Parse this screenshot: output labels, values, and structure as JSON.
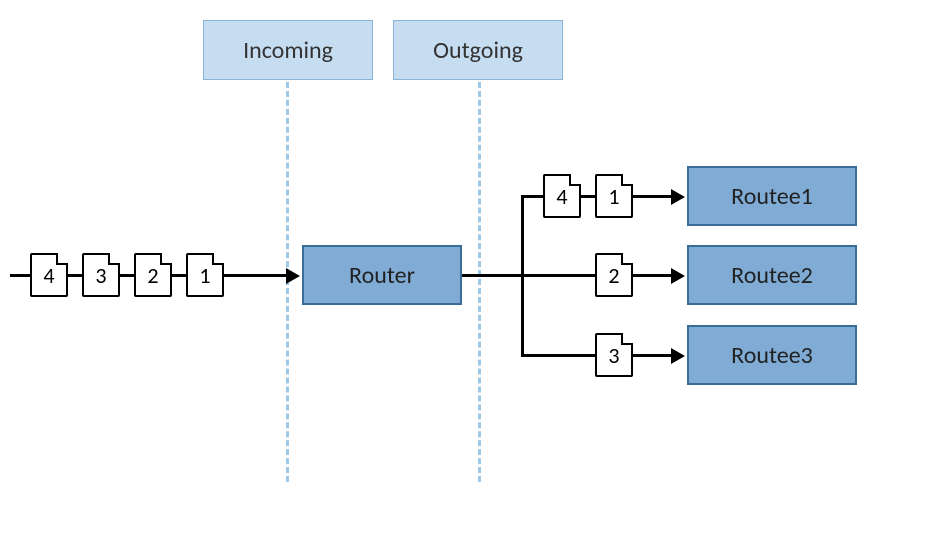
{
  "labels": {
    "incoming": "Incoming",
    "outgoing": "Outgoing"
  },
  "router": "Router",
  "routees": [
    "Routee1",
    "Routee2",
    "Routee3"
  ],
  "incoming_queue": [
    "4",
    "3",
    "2",
    "1"
  ],
  "outgoing": {
    "to_routee1": [
      "4",
      "1"
    ],
    "to_routee2": [
      "2"
    ],
    "to_routee3": [
      "3"
    ]
  },
  "colors": {
    "label_fill": "#c5dcf1",
    "label_border": "#8ab4d8",
    "node_fill": "#7fabd4",
    "node_border": "#3a6d9a",
    "dash": "#9ec8e8"
  }
}
